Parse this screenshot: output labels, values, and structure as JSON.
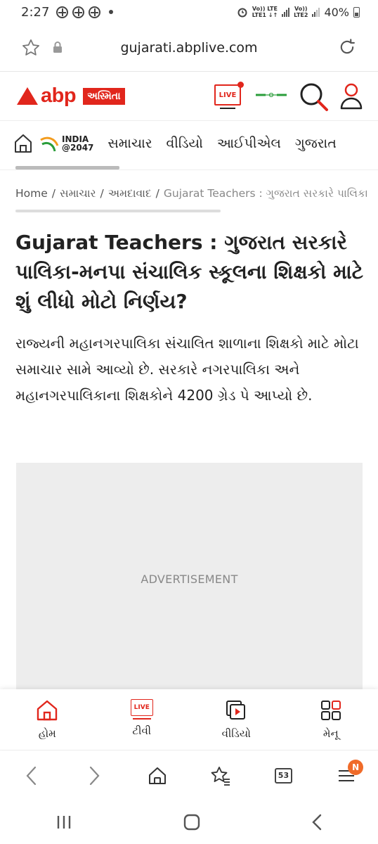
{
  "status_bar": {
    "time": "2:27",
    "network_top": "Vo)) LTE",
    "network_top_sub": "LTE1 ↓↑",
    "network_bottom": "Vo))",
    "network_bottom_sub": "LTE2",
    "battery": "40%"
  },
  "browser": {
    "url": "gujarati.abplive.com",
    "tabs_count": "53",
    "menu_badge": "N"
  },
  "header": {
    "logo_text": "abp",
    "logo_badge": "અસ્મિતા",
    "live_label": "LIVE"
  },
  "nav": {
    "india_line1": "INDIA",
    "india_line2": "@2047",
    "items": [
      "સમાચાર",
      "વીડિયો",
      "આઈપીએલ",
      "ગુજરાત"
    ]
  },
  "breadcrumb": {
    "home": "Home",
    "level1": "સમાચાર",
    "level2": "અમદાવાદ",
    "current": "Gujarat Teachers : ગુજરાત સરકારે પાલિકા"
  },
  "article": {
    "headline": "Gujarat Teachers : ગુજરાત સરકારે પાલિકા-મનપા સંચાલિક સ્કૂલના શિક્ષકો માટે શું લીધો મોટો નિર્ણય?",
    "summary": "રાજ્યની મહાનગરપાલિકા સંચાલિત શાળાના શિક્ષકો માટે મોટા સમાચાર સામે આવ્યો છે. સરકારે નગરપાલિકા અને મહાનગરપાલિકાના શિક્ષકોને 4200 ગ્રેડ પે આપ્યો છે."
  },
  "ad": {
    "label": "ADVERTISEMENT"
  },
  "app_nav": {
    "home": "હોમ",
    "tv": "ટીવી",
    "tv_icon_text": "LIVE",
    "video": "વીડિયો",
    "menu": "મેનૂ"
  },
  "colors": {
    "brand_red": "#e1261c",
    "badge_orange": "#f06b29"
  }
}
